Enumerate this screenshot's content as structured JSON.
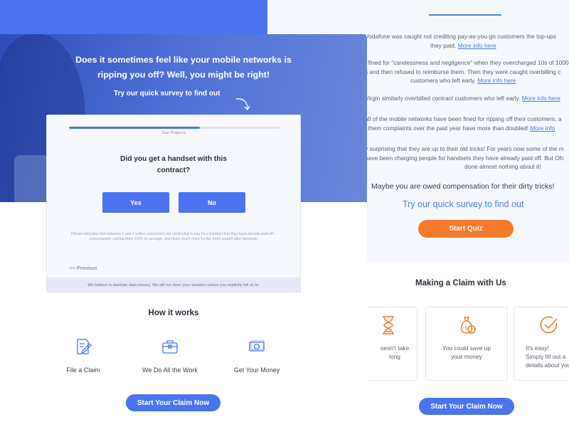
{
  "right_page": {
    "paragraphs": [
      {
        "text": "Vodafone was caught not crediting pay-as-you-go customers the top-ups",
        "text2": "they paid.",
        "link": "More info here"
      },
      {
        "text": "t fined for \"carelessness and negligence\" when they overcharged 10s of 1000",
        "text2": "s and then refused to reimburse them.  Then they were caught overbilling c",
        "text3": "customers who left early.",
        "link": "More info here"
      },
      {
        "text": "Virgin similarly overbilled contract customers who left early.",
        "link": "More info here"
      },
      {
        "text": "all of the mobile networks have been fined for ripping off their customers, a",
        "text2": "f them  complaints over the past year have more than doubled!",
        "link": "More info"
      },
      {
        "text": "y surprising that they are up to their old tricks!  For years now some of the m",
        "text2": "have been charging people for handsets they have already paid off.  But Ofc",
        "text3": "done almost nothing about it!"
      }
    ],
    "owed": "Maybe you are owed compensation for their dirty tricks!",
    "try_survey": "Try our quick survey to find out",
    "start_quiz": "Start Quiz",
    "claim_title": "Making a Claim with Us",
    "cards": [
      {
        "text": "oesn't take\nlong",
        "icon": "hourglass-icon"
      },
      {
        "text": "You could save up\nyour money",
        "icon": "money-bag-icon"
      },
      {
        "text": "It's easy!\nSimply fill out a\ndetails about you",
        "icon": "checkmark-circle-icon"
      }
    ],
    "start_claim": "Start Your Claim Now"
  },
  "hero": {
    "headline": "Does it sometimes feel like your mobile networks is ripping you off? Well, you might be right!",
    "try": "Try our quick survey to find out"
  },
  "survey": {
    "progress": 0.62,
    "progress_label": "Your Progress",
    "question": "Did you get a handset with this contract?",
    "yes": "Yes",
    "no": "No",
    "note": "Ofcom estimates that between 1 and 2 million consumers are continuing to pay for a handset that they have already paid off – unnecessarily costing them £220 on average, and much much more for the more sought after handsets.",
    "previous": "<< Previous",
    "privacy": "We believe in absolute data privacy.  We will not store your answers unless you explicitly tell us to."
  },
  "how": {
    "title": "How it works",
    "steps": [
      {
        "label": "File a Claim",
        "icon": "document-edit-icon"
      },
      {
        "label": "We Do All the Work",
        "icon": "briefcase-icon"
      },
      {
        "label": "Get Your Money",
        "icon": "cash-icon"
      }
    ],
    "start_claim": "Start Your Claim Now"
  },
  "colors": {
    "accent": "#4b73f0",
    "orange": "#f57a2b",
    "link": "#4a7ae8"
  }
}
